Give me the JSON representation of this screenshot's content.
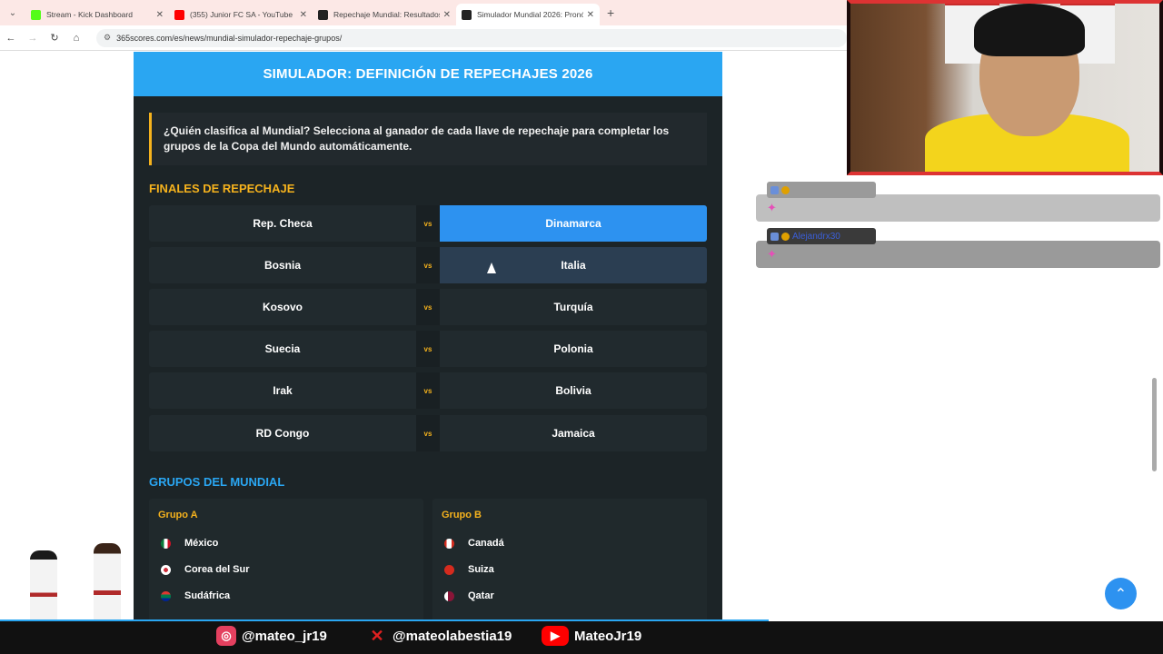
{
  "browser": {
    "tabs": [
      {
        "title": "Stream - Kick Dashboard",
        "fav_color": "#53fc18"
      },
      {
        "title": "(355) Junior FC SA - YouTube",
        "fav_color": "#ff0000"
      },
      {
        "title": "Repechaje Mundial: Resultados",
        "fav_color": "#222222"
      },
      {
        "title": "Simulador Mundial 2026: Pronó",
        "fav_color": "#222222"
      }
    ],
    "url": "365scores.com/es/news/mundial-simulador-repechaje-grupos/"
  },
  "simulator": {
    "banner": "SIMULADOR: DEFINICIÓN DE REPECHAJES 2026",
    "note": "¿Quién clasifica al Mundial? Selecciona al ganador de cada llave de repechaje para completar los grupos de la Copa del Mundo automáticamente.",
    "finals_title": "FINALES DE REPECHAJE",
    "vs_label": "vs",
    "matches": [
      {
        "home": "Rep. Checa",
        "away": "Dinamarca"
      },
      {
        "home": "Bosnia",
        "away": "Italia"
      },
      {
        "home": "Kosovo",
        "away": "Turquía"
      },
      {
        "home": "Suecia",
        "away": "Polonia"
      },
      {
        "home": "Irak",
        "away": "Bolivia"
      },
      {
        "home": "RD Congo",
        "away": "Jamaica"
      }
    ],
    "groups_title": "GRUPOS DEL MUNDIAL",
    "groups": [
      {
        "name": "Grupo A",
        "teams": [
          "México",
          "Corea del Sur",
          "Sudáfrica"
        ]
      },
      {
        "name": "Grupo B",
        "teams": [
          "Canadá",
          "Suiza",
          "Qatar"
        ]
      }
    ]
  },
  "chat": {
    "user2": "Alejandrx30"
  },
  "socials": {
    "instagram": "@mateo_jr19",
    "x": "@mateolabestia19",
    "youtube": "MateoJr19"
  },
  "colors": {
    "accent": "#2aa6f2",
    "gold": "#f5b21d",
    "selected": "#2d92f0"
  }
}
